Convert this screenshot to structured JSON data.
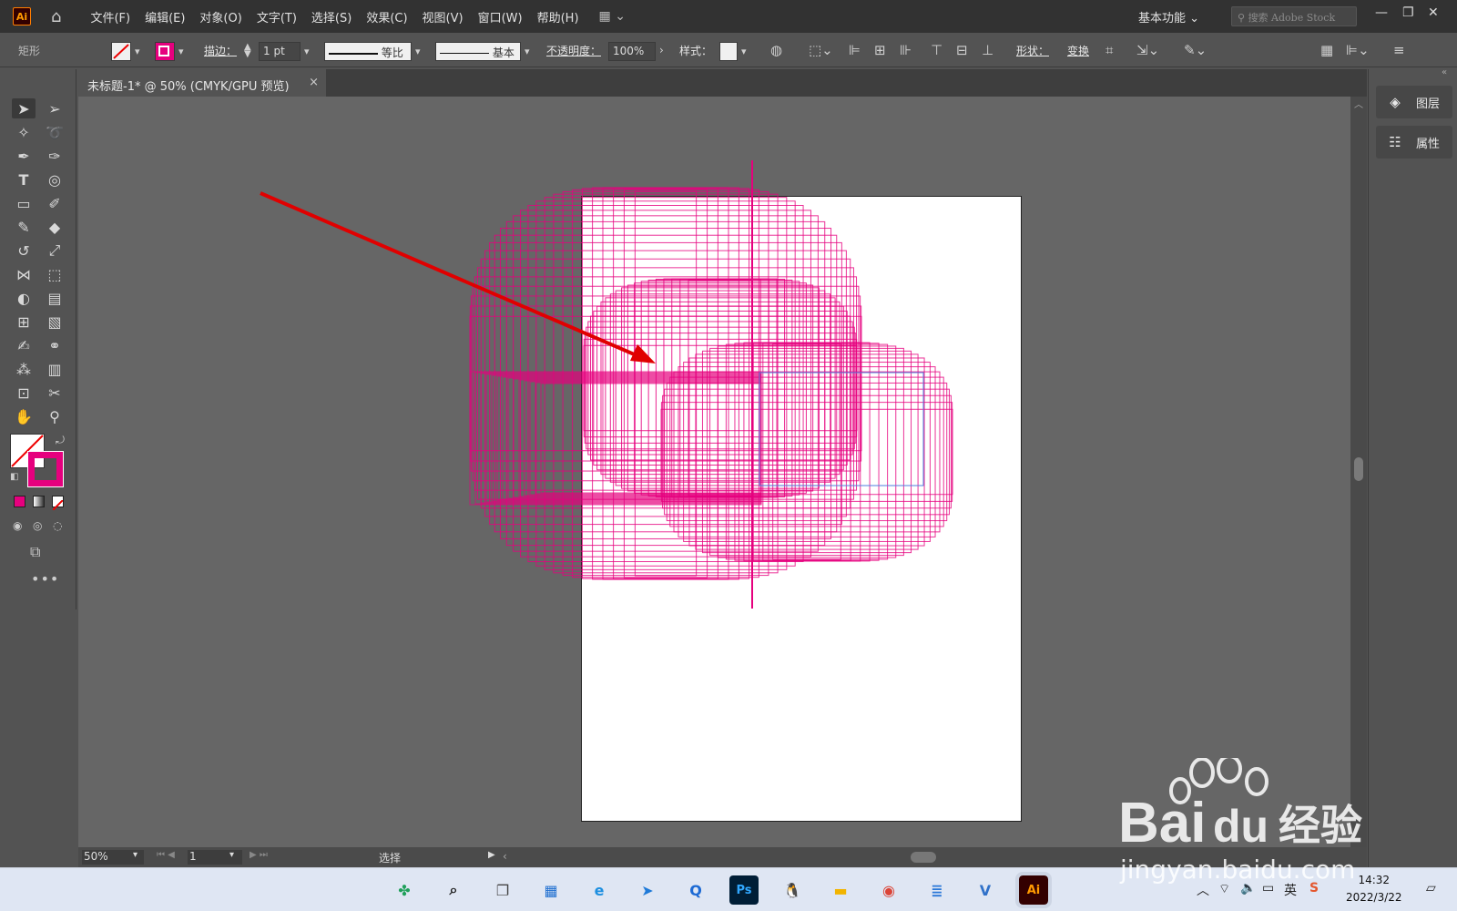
{
  "menubar": {
    "items": [
      "文件(F)",
      "编辑(E)",
      "对象(O)",
      "文字(T)",
      "选择(S)",
      "效果(C)",
      "视图(V)",
      "窗口(W)",
      "帮助(H)"
    ],
    "workspace": "基本功能",
    "search_placeholder": "搜索 Adobe Stock",
    "logo_text": "Ai"
  },
  "controlbar": {
    "object_type": "矩形",
    "stroke_label": "描边：",
    "stroke_value": "1 pt",
    "stroke_profile": "等比",
    "brush_def": "基本",
    "opacity_label": "不透明度：",
    "opacity_value": "100%",
    "style_label": "样式：",
    "shape_label": "形状：",
    "transform_label": "变换"
  },
  "document": {
    "tab_title": "未标题-1* @ 50% (CMYK/GPU 预览)",
    "close_symbol": "×"
  },
  "statusbar": {
    "zoom": "50%",
    "artboard_number": "1",
    "tool_status": "选择"
  },
  "rightpanel": {
    "items": [
      {
        "label": "图层",
        "icon": "layers-icon"
      },
      {
        "label": "属性",
        "icon": "properties-icon"
      }
    ]
  },
  "colors": {
    "stroke": "#e6007e",
    "arrow": "#e00000",
    "accent": "#ff7c00"
  },
  "taskbar": {
    "time": "14:32",
    "date": "2022/3/22",
    "ime": "英",
    "apps": [
      {
        "name": "start-icon",
        "glyph": "✤",
        "color": "#1fa05a"
      },
      {
        "name": "search-icon",
        "glyph": "⌕",
        "color": "#1a1a1a"
      },
      {
        "name": "taskview-icon",
        "glyph": "❐",
        "color": "#444"
      },
      {
        "name": "widgets-icon",
        "glyph": "▦",
        "color": "#1f6fd0"
      },
      {
        "name": "edge-icon",
        "glyph": "e",
        "color": "#1d8fe0"
      },
      {
        "name": "feishu-icon",
        "glyph": "➤",
        "color": "#1f7ad8"
      },
      {
        "name": "qq-browser-icon",
        "glyph": "Q",
        "color": "#1d6ad4"
      },
      {
        "name": "photoshop-icon",
        "glyph": "Ps",
        "color": "#31a8ff"
      },
      {
        "name": "qq-icon",
        "glyph": "🐧",
        "color": "#111"
      },
      {
        "name": "explorer-icon",
        "glyph": "▬",
        "color": "#f2b400"
      },
      {
        "name": "chrome-icon",
        "glyph": "◉",
        "color": "#db4437"
      },
      {
        "name": "notepad-icon",
        "glyph": "≣",
        "color": "#2b78d8"
      },
      {
        "name": "visio-icon",
        "glyph": "V",
        "color": "#3071c9"
      },
      {
        "name": "illustrator-icon",
        "glyph": "Ai",
        "color": "#ff9a00"
      }
    ]
  },
  "watermark": {
    "brand": "Bai",
    "brand_suffix": "du",
    "cn": "经验",
    "url": "jingyan.baidu.com"
  }
}
